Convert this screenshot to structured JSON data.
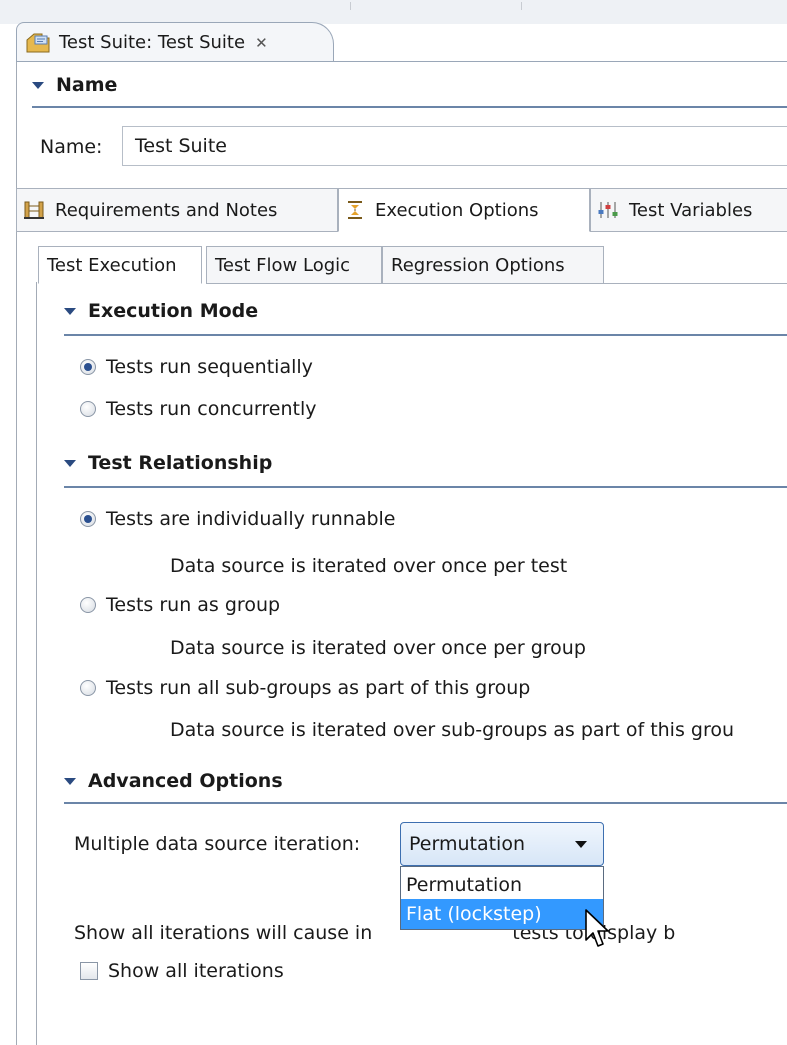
{
  "editor_tab": {
    "icon": "test-suite-icon",
    "title": "Test Suite: Test Suite",
    "close_glyph": "✕"
  },
  "name_section": {
    "title": "Name",
    "label": "Name:",
    "value": "Test Suite"
  },
  "main_tabs": [
    {
      "label": "Requirements and Notes",
      "icon": "requirements-icon",
      "active": false
    },
    {
      "label": "Execution Options",
      "icon": "execution-icon",
      "active": true
    },
    {
      "label": "Test Variables",
      "icon": "variables-icon",
      "active": false
    }
  ],
  "sub_tabs": [
    {
      "label": "Test Execution",
      "active": true
    },
    {
      "label": "Test Flow Logic",
      "active": false
    },
    {
      "label": "Regression Options",
      "active": false
    }
  ],
  "execution_mode": {
    "title": "Execution Mode",
    "options": [
      {
        "label": "Tests run sequentially",
        "selected": true
      },
      {
        "label": "Tests run concurrently",
        "selected": false
      }
    ]
  },
  "test_relationship": {
    "title": "Test Relationship",
    "options": [
      {
        "label": "Tests are individually runnable",
        "description": "Data source is iterated over once per test",
        "selected": true
      },
      {
        "label": "Tests run as group",
        "description": "Data source is iterated over once per group",
        "selected": false
      },
      {
        "label": "Tests run all sub-groups as part of this group",
        "description": "Data source is iterated over sub-groups as part of this grou",
        "selected": false
      }
    ]
  },
  "advanced_options": {
    "title": "Advanced Options",
    "iteration_label": "Multiple data source iteration:",
    "iteration_value": "Permutation",
    "dropdown_options": [
      "Permutation",
      "Flat (lockstep)"
    ],
    "highlighted_option": "Flat (lockstep)",
    "show_iterations_note_start": "Show all iterations will cause in",
    "show_iterations_note_end": "tests to display b",
    "show_iterations_label": "Show all iterations",
    "show_iterations_checked": false
  },
  "colors": {
    "accent_line": "#6b85a8",
    "selection": "#3399ff",
    "combo_border": "#3d6fb0"
  }
}
